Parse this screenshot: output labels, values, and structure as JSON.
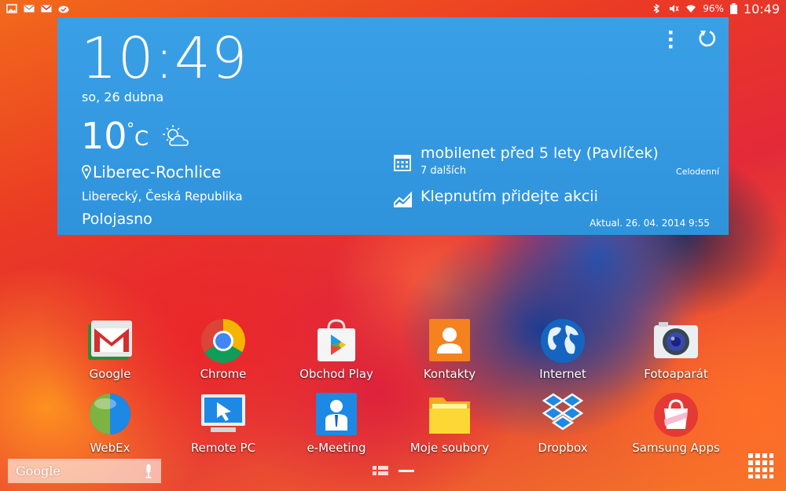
{
  "status_bar": {
    "battery_percent": "96%",
    "time": "10:49"
  },
  "widget": {
    "time": "10:49",
    "date": "so, 26 dubna",
    "temperature": "10",
    "degree_symbol": "°",
    "unit": "C",
    "city": "Liberec-Rochlice",
    "region": "Liberecký, Česká Republika",
    "condition": "Polojasno",
    "event_title": "mobilenet před 5 lety (Pavlíček)",
    "event_more": "7 dalších",
    "event_allday": "Celodenní",
    "add_event": "Klepnutím přidejte akcii",
    "updated": "Aktual. 26. 04. 2014 9:55"
  },
  "apps": [
    {
      "label": "Google"
    },
    {
      "label": "Chrome"
    },
    {
      "label": "Obchod Play"
    },
    {
      "label": "Kontakty"
    },
    {
      "label": "Internet"
    },
    {
      "label": "Fotoaparát"
    },
    {
      "label": "WebEx"
    },
    {
      "label": "Remote PC"
    },
    {
      "label": "e-Meeting"
    },
    {
      "label": "Moje soubory"
    },
    {
      "label": "Dropbox"
    },
    {
      "label": "Samsung Apps"
    }
  ],
  "search": {
    "label": "Google"
  },
  "colors": {
    "widget_bg": "#3aa0e6",
    "contacts_orange": "#f5821f",
    "dropbox_blue": "#1e88e5"
  }
}
